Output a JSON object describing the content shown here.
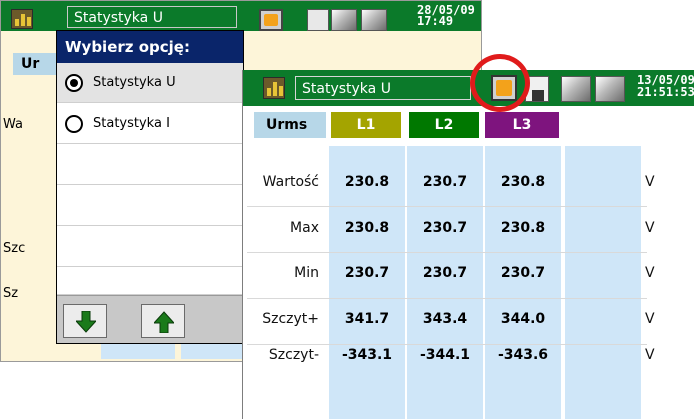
{
  "back_window": {
    "title": "Statystyka U",
    "datetime": "28/05/09\n17:49",
    "ur_label": "Ur",
    "row_labels": [
      "Wa",
      "Szc",
      "Sz"
    ]
  },
  "dialog": {
    "title": "Wybierz opcję:",
    "options": [
      {
        "label": "Statystyka U",
        "selected": true
      },
      {
        "label": "Statystyka I",
        "selected": false
      }
    ]
  },
  "front_window": {
    "title": "Statystyka U",
    "datetime": "13/05/09\n21:51:53",
    "table": {
      "header": "Urms",
      "phases": [
        "L1",
        "L2",
        "L3"
      ],
      "phase_colors": [
        "#a4a400",
        "#007800",
        "#7e147e"
      ],
      "rows": [
        {
          "label": "Wartość",
          "values": [
            "230.8",
            "230.7",
            "230.8"
          ],
          "unit": "V"
        },
        {
          "label": "Max",
          "values": [
            "230.8",
            "230.7",
            "230.8"
          ],
          "unit": "V"
        },
        {
          "label": "Min",
          "values": [
            "230.7",
            "230.7",
            "230.7"
          ],
          "unit": "V"
        },
        {
          "label": "Szczyt+",
          "values": [
            "341.7",
            "343.4",
            "344.0"
          ],
          "unit": "V"
        },
        {
          "label": "Szczyt-",
          "values": [
            "-343.1",
            "-344.1",
            "-343.6"
          ],
          "unit": "V"
        }
      ]
    }
  },
  "icons": {
    "app": "bar-chart-icon",
    "swap": "swap-icon",
    "save": "sd-card-icon",
    "down": "arrow-down-icon",
    "up": "arrow-up-icon"
  }
}
